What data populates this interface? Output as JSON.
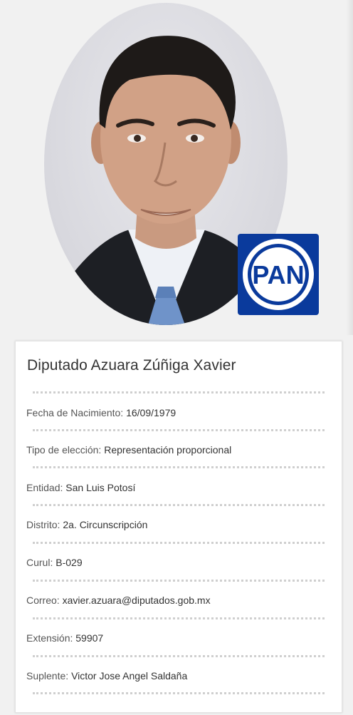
{
  "profile": {
    "photo_alt": "deputy-portrait",
    "party_logo_text": "PAN",
    "party_color": "#0a3a9c",
    "title": "Diputado Azuara Zúñiga Xavier"
  },
  "details": [
    {
      "label": "Fecha de Nacimiento:",
      "value": "16/09/1979"
    },
    {
      "label": "Tipo de elección:",
      "value": "Representación proporcional"
    },
    {
      "label": "Entidad:",
      "value": "San Luis Potosí"
    },
    {
      "label": "Distrito:",
      "value": "2a. Circunscripción"
    },
    {
      "label": "Curul:",
      "value": "B-029"
    },
    {
      "label": "Correo:",
      "value": "xavier.azuara@diputados.gob.mx"
    },
    {
      "label": "Extensión:",
      "value": "59907"
    },
    {
      "label": "Suplente:",
      "value": "Victor Jose Angel Saldaña"
    }
  ]
}
